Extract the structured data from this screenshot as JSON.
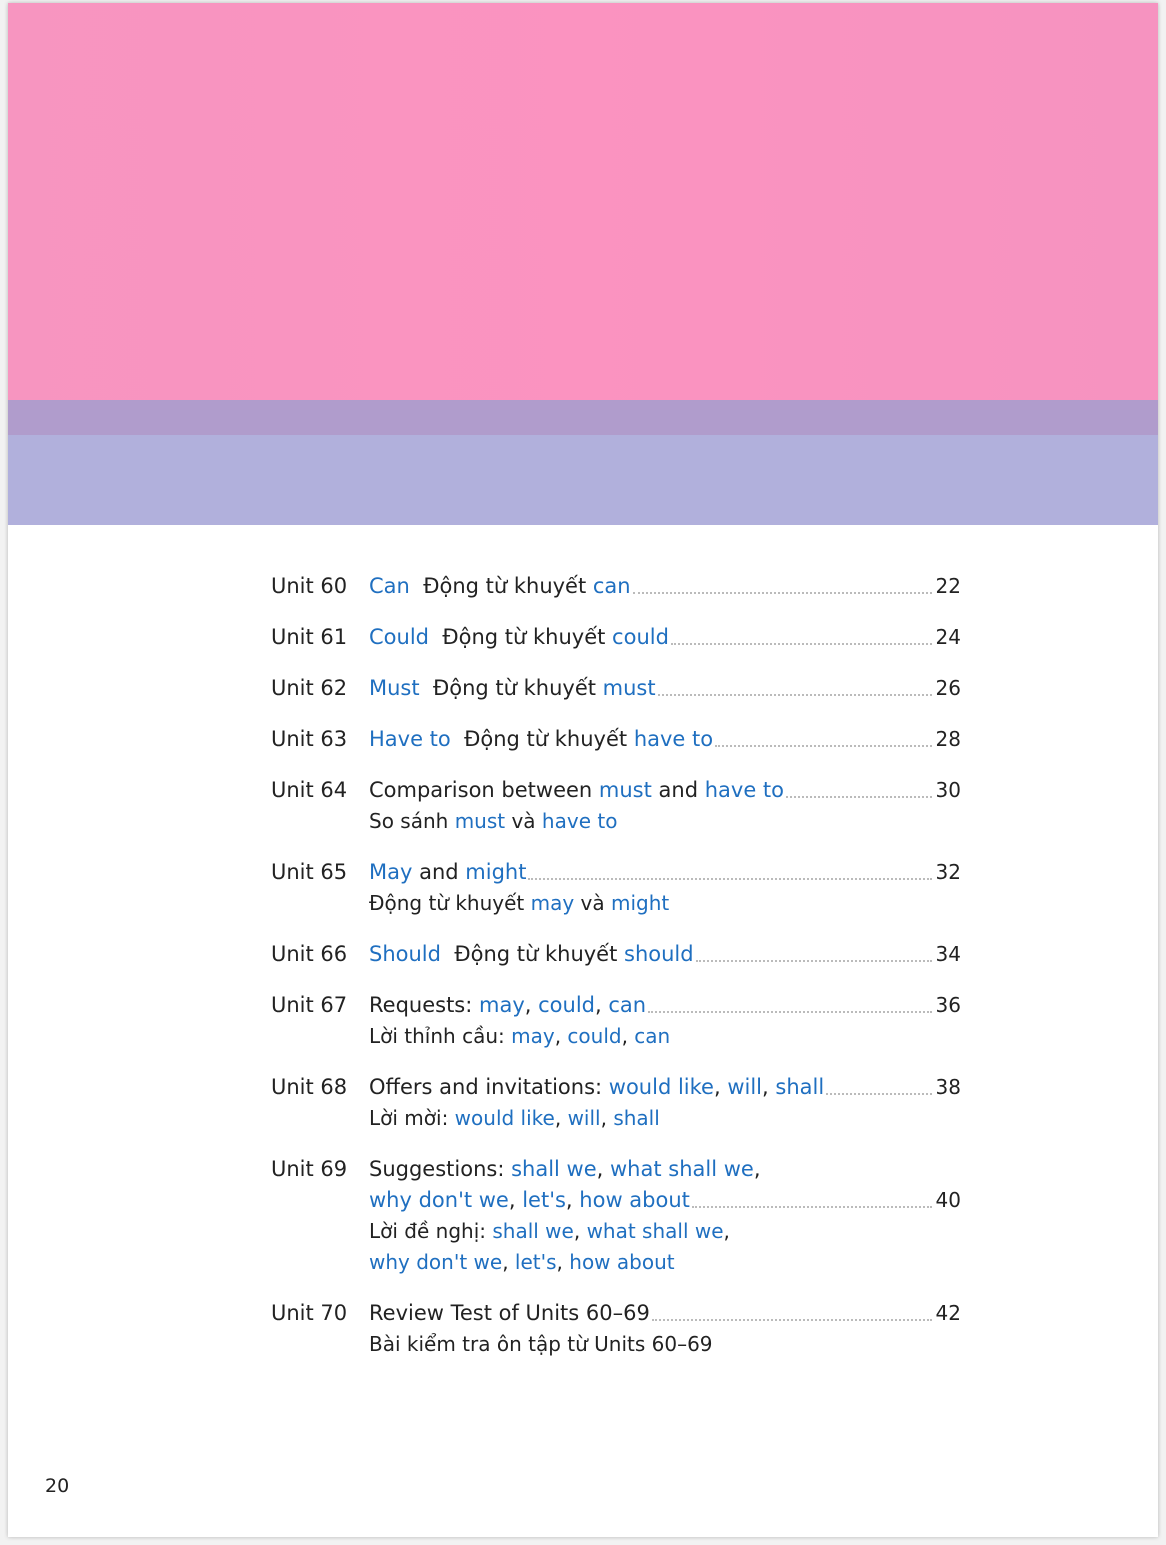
{
  "colors": {
    "header_pink": "#f795c0",
    "band_purple": "#b09ccc",
    "band_lavender": "#b1b0dc",
    "highlight": "#1f6fc0"
  },
  "entries": [
    {
      "unit": "Unit 60",
      "page": "22",
      "title": [
        [
          [
            "Can",
            1
          ],
          [
            "  Động từ khuyết ",
            0
          ],
          [
            "can",
            1
          ]
        ]
      ],
      "subtitle": []
    },
    {
      "unit": "Unit 61",
      "page": "24",
      "title": [
        [
          [
            "Could",
            1
          ],
          [
            "  Động từ khuyết ",
            0
          ],
          [
            "could",
            1
          ]
        ]
      ],
      "subtitle": []
    },
    {
      "unit": "Unit 62",
      "page": "26",
      "title": [
        [
          [
            "Must",
            1
          ],
          [
            "  Động từ khuyết ",
            0
          ],
          [
            "must",
            1
          ]
        ]
      ],
      "subtitle": []
    },
    {
      "unit": "Unit 63",
      "page": "28",
      "title": [
        [
          [
            "Have to",
            1
          ],
          [
            "  Động từ khuyết ",
            0
          ],
          [
            "have to",
            1
          ]
        ]
      ],
      "subtitle": []
    },
    {
      "unit": "Unit 64",
      "page": "30",
      "title": [
        [
          [
            "Comparison between ",
            0
          ],
          [
            "must",
            1
          ],
          [
            " and ",
            0
          ],
          [
            "have to",
            1
          ]
        ]
      ],
      "subtitle": [
        [
          [
            "So sánh ",
            0
          ],
          [
            "must",
            1
          ],
          [
            " và ",
            0
          ],
          [
            "have to",
            1
          ]
        ]
      ]
    },
    {
      "unit": "Unit 65",
      "page": "32",
      "title": [
        [
          [
            "May",
            1
          ],
          [
            " and ",
            0
          ],
          [
            "might",
            1
          ]
        ]
      ],
      "subtitle": [
        [
          [
            "Động từ khuyết ",
            0
          ],
          [
            "may",
            1
          ],
          [
            " và ",
            0
          ],
          [
            "might",
            1
          ]
        ]
      ]
    },
    {
      "unit": "Unit 66",
      "page": "34",
      "title": [
        [
          [
            "Should",
            1
          ],
          [
            "  Động từ khuyết ",
            0
          ],
          [
            "should",
            1
          ]
        ]
      ],
      "subtitle": []
    },
    {
      "unit": "Unit 67",
      "page": "36",
      "title": [
        [
          [
            "Requests: ",
            0
          ],
          [
            "may",
            1
          ],
          [
            ", ",
            0
          ],
          [
            "could",
            1
          ],
          [
            ", ",
            0
          ],
          [
            "can",
            1
          ]
        ]
      ],
      "subtitle": [
        [
          [
            "Lời thỉnh cầu: ",
            0
          ],
          [
            "may",
            1
          ],
          [
            ", ",
            0
          ],
          [
            "could",
            1
          ],
          [
            ", ",
            0
          ],
          [
            "can",
            1
          ]
        ]
      ]
    },
    {
      "unit": "Unit 68",
      "page": "38",
      "title": [
        [
          [
            "Offers and invitations: ",
            0
          ],
          [
            "would like",
            1
          ],
          [
            ", ",
            0
          ],
          [
            "will",
            1
          ],
          [
            ", ",
            0
          ],
          [
            "shall",
            1
          ]
        ]
      ],
      "subtitle": [
        [
          [
            "Lời mời: ",
            0
          ],
          [
            "would like",
            1
          ],
          [
            ", ",
            0
          ],
          [
            "will",
            1
          ],
          [
            ", ",
            0
          ],
          [
            "shall",
            1
          ]
        ]
      ]
    },
    {
      "unit": "Unit 69",
      "page": "40",
      "title": [
        [
          [
            "Suggestions: ",
            0
          ],
          [
            "shall we",
            1
          ],
          [
            ", ",
            0
          ],
          [
            "what shall we",
            1
          ],
          [
            ",",
            0
          ]
        ],
        [
          [
            "why don't we",
            1
          ],
          [
            ", ",
            0
          ],
          [
            "let's",
            1
          ],
          [
            ", ",
            0
          ],
          [
            "how about",
            1
          ]
        ]
      ],
      "subtitle": [
        [
          [
            "Lời đề nghị: ",
            0
          ],
          [
            "shall we",
            1
          ],
          [
            ", ",
            0
          ],
          [
            "what shall we",
            1
          ],
          [
            ",",
            0
          ]
        ],
        [
          [
            "why don't we",
            1
          ],
          [
            ", ",
            0
          ],
          [
            "let's",
            1
          ],
          [
            ", ",
            0
          ],
          [
            "how about",
            1
          ]
        ]
      ]
    },
    {
      "unit": "Unit 70",
      "page": "42",
      "title": [
        [
          [
            "Review Test of Units 60–69",
            0
          ]
        ]
      ],
      "subtitle": [
        [
          [
            "Bài kiểm tra ôn tập từ Units 60–69",
            0
          ]
        ]
      ]
    }
  ],
  "page_number": "20"
}
